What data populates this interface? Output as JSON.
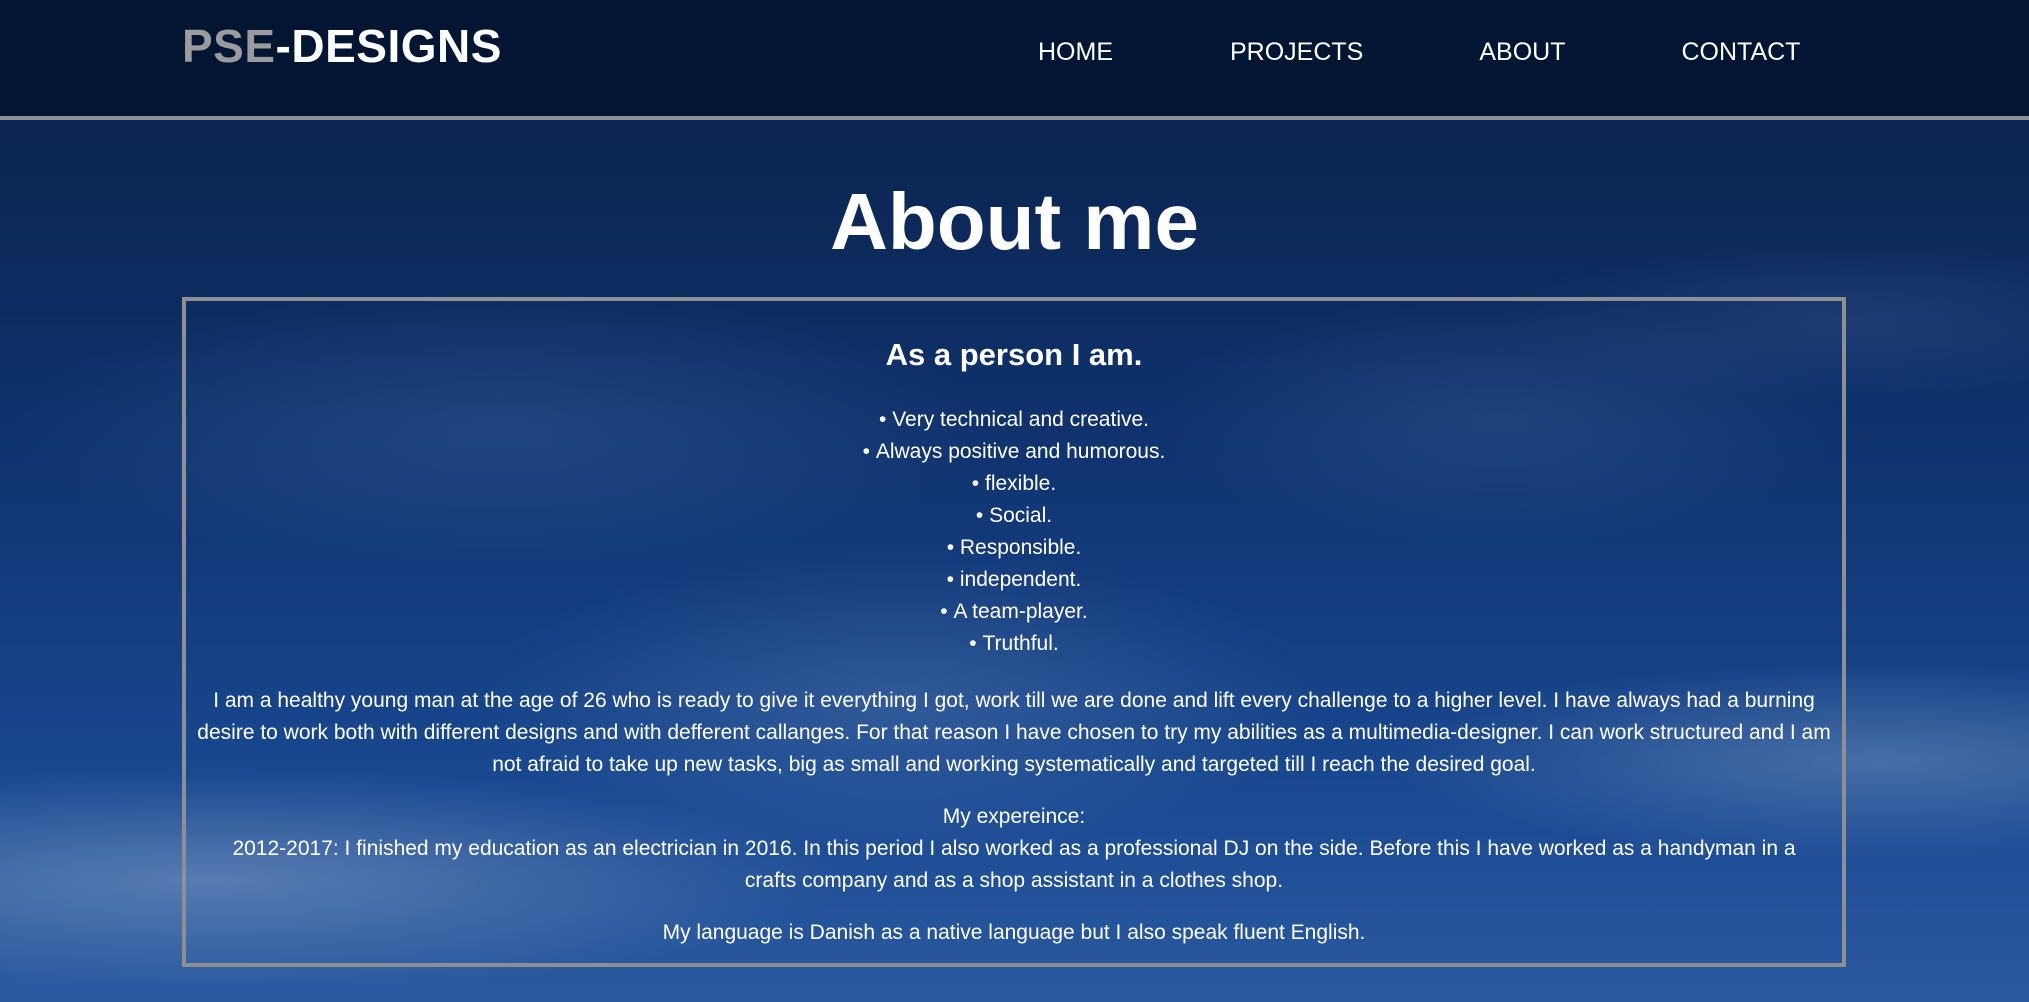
{
  "header": {
    "logo_part1": "PSE",
    "logo_part2": "-DESIGNS",
    "nav": {
      "home": "HOME",
      "projects": "PROJECTS",
      "about": "ABOUT",
      "contact": "CONTACT"
    }
  },
  "main": {
    "title": "About me",
    "box": {
      "heading": "As a person I am.",
      "traits": [
        "Very technical and creative.",
        "Always positive and humorous.",
        "flexible.",
        "Social.",
        "Responsible.",
        "independent.",
        "A team-player.",
        "Truthful."
      ],
      "intro": "I am a healthy young man at the age of 26 who is ready to give it everything I got, work till we are done and lift every challenge to a higher level. I have always had a burning desire to work both with different designs and with defferent callanges. For that reason I have chosen to try my abilities as a multimedia-designer. I can work structured and I am not afraid to take up new tasks, big as small and working systematically and targeted till I reach the desired goal.",
      "experience_heading": "My expereince:",
      "experience_text": "2012-2017: I finished my education as an electrician in 2016. In this period I also worked as a professional DJ on the side. Before this I have worked as a handyman in a crafts company and as a shop assistant in a clothes shop.",
      "language": "My language is Danish as a native language but I also speak fluent English."
    }
  },
  "colors": {
    "header_bg": "#021633",
    "logo_gray": "#9a9b9f",
    "border_gray": "#8e8f93",
    "text": "#ffffff"
  }
}
